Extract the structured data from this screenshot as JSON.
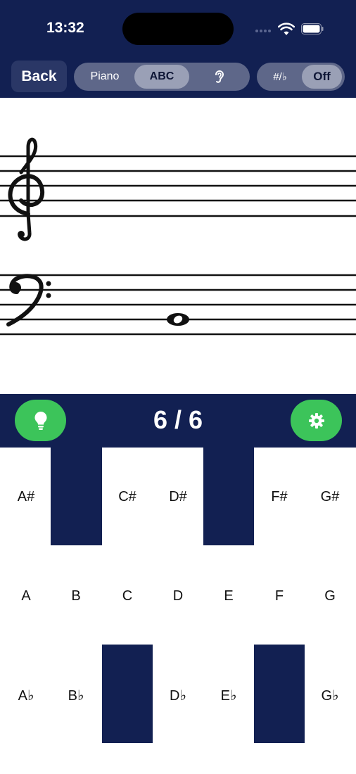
{
  "status": {
    "time": "13:32",
    "icons": [
      "signal-dots-icon",
      "wifi-icon",
      "battery-icon"
    ]
  },
  "header": {
    "back_label": "Back",
    "modes": [
      {
        "label": "Piano",
        "active": false
      },
      {
        "label": "ABC",
        "active": true
      },
      {
        "label": "",
        "icon": "ear-icon",
        "active": false
      }
    ],
    "accidental_label": "#/♭",
    "accidental_value": "Off"
  },
  "staff": {
    "clefs": [
      "treble",
      "bass"
    ],
    "note": "whole-note-on-bass-staff"
  },
  "bar": {
    "progress": "6 / 6",
    "hint_icon": "lightbulb-icon",
    "settings_icon": "gear-icon"
  },
  "keys": {
    "sharps": [
      "A#",
      "",
      "C#",
      "D#",
      "",
      "F#",
      "G#"
    ],
    "naturals": [
      "A",
      "B",
      "C",
      "D",
      "E",
      "F",
      "G"
    ],
    "flats": [
      "A♭",
      "B♭",
      "",
      "D♭",
      "E♭",
      "",
      "G♭"
    ]
  },
  "colors": {
    "navy": "#122052",
    "green": "#3cc45a",
    "segment": "#5e6789"
  }
}
